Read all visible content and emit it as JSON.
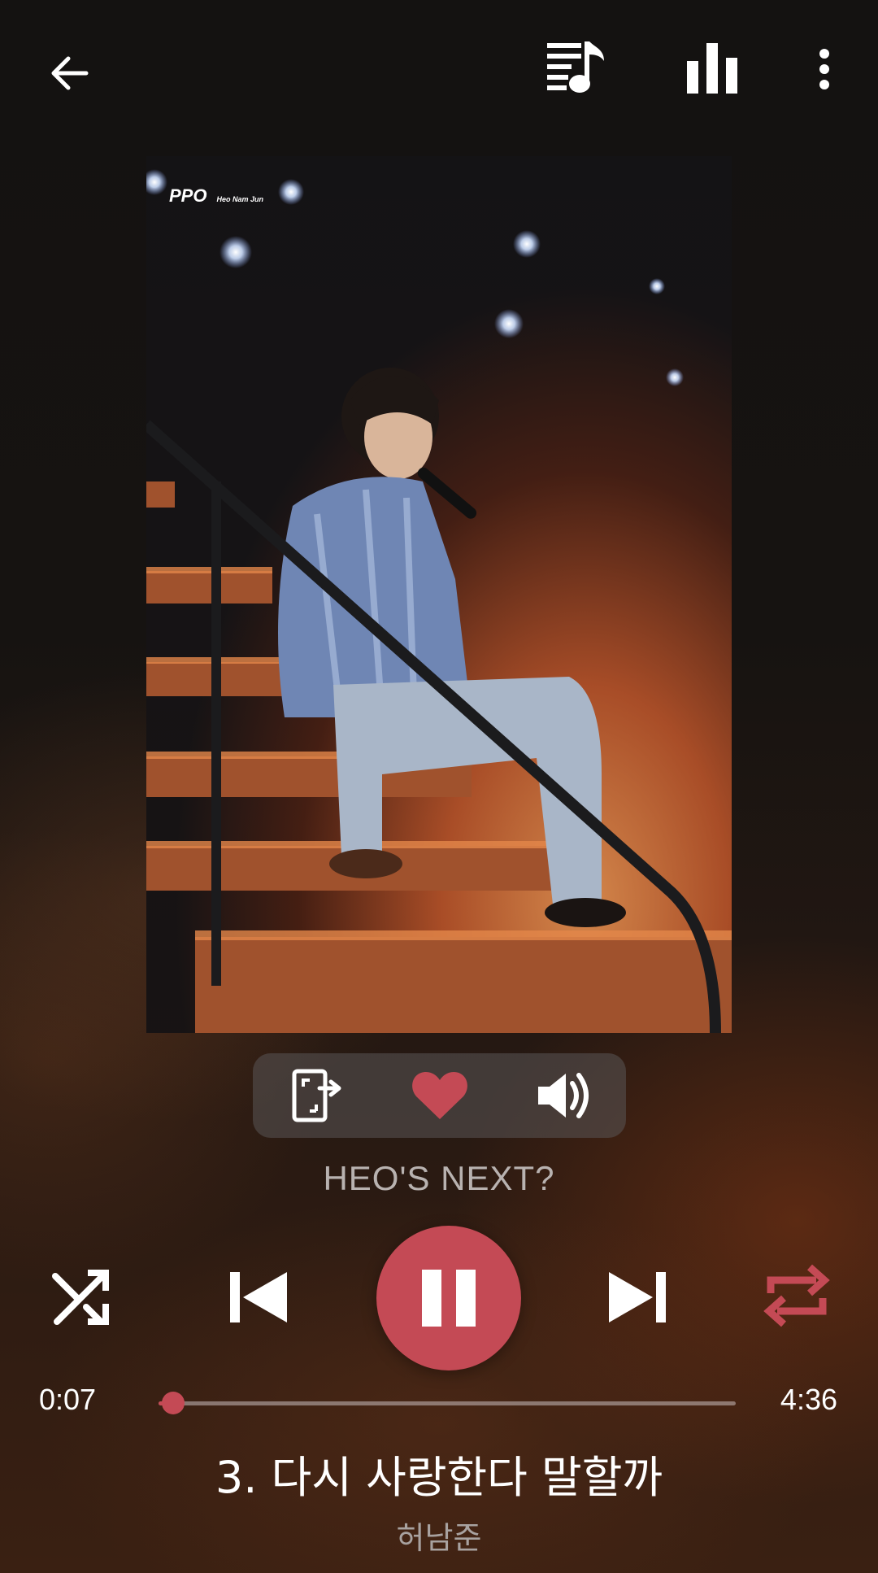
{
  "header": {
    "back_icon": "arrow-left-icon",
    "queue_icon": "playlist-music-icon",
    "equalizer_icon": "bar-chart-icon",
    "menu_icon": "more-vertical-icon"
  },
  "album_art": {
    "caption_main": "PPO",
    "caption_sub": "Heo Nam Jun"
  },
  "actions": {
    "cast_icon": "cast-to-device-icon",
    "favorite_icon": "heart-icon",
    "favorite_active": true,
    "volume_icon": "volume-icon"
  },
  "album_title": "HEO'S NEXT?",
  "controls": {
    "shuffle_icon": "shuffle-icon",
    "previous_icon": "skip-previous-icon",
    "play_pause_icon": "pause-icon",
    "next_icon": "skip-next-icon",
    "repeat_icon": "repeat-icon",
    "repeat_active": true
  },
  "progress": {
    "elapsed": "0:07",
    "total": "4:36",
    "fraction": 0.0254
  },
  "track": {
    "title": "3. 다시 사랑한다 말할까",
    "artist": "허남준"
  },
  "colors": {
    "accent": "#c44a55",
    "icon": "#ffffff",
    "muted_text": "#b8b2b0"
  }
}
